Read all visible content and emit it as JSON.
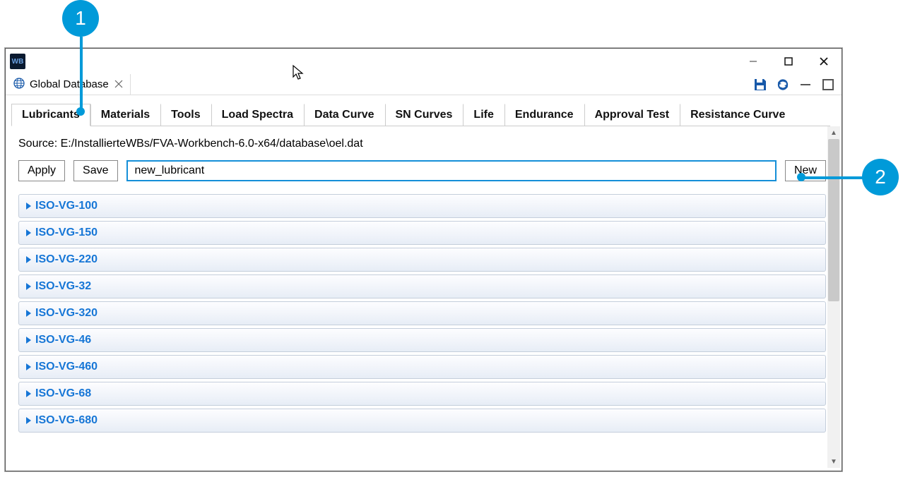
{
  "app_icon_text": "WB",
  "editor_tab": {
    "title": "Global Database"
  },
  "category_tabs": [
    "Lubricants",
    "Materials",
    "Tools",
    "Load Spectra",
    "Data Curve",
    "SN Curves",
    "Life",
    "Endurance",
    "Approval Test",
    "Resistance Curve"
  ],
  "active_tab_index": 0,
  "source_line": "Source: E:/InstallierteWBs/FVA-Workbench-6.0-x64/database\\oel.dat",
  "buttons": {
    "apply": "Apply",
    "save": "Save",
    "new": "New"
  },
  "input": {
    "value": "new_lubricant"
  },
  "items": [
    "ISO-VG-100",
    "ISO-VG-150",
    "ISO-VG-220",
    "ISO-VG-32",
    "ISO-VG-320",
    "ISO-VG-46",
    "ISO-VG-460",
    "ISO-VG-68",
    "ISO-VG-680"
  ],
  "callouts": {
    "c1": "1",
    "c2": "2"
  }
}
